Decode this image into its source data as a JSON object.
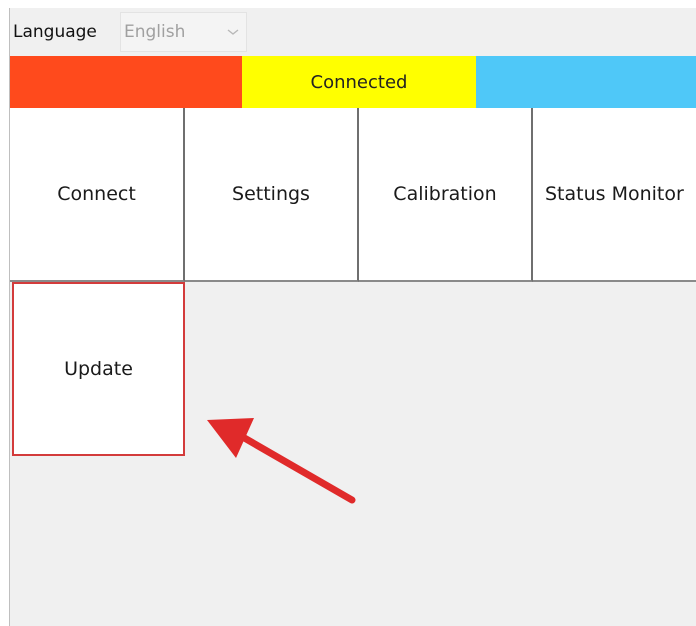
{
  "language": {
    "label": "Language",
    "selected": "English"
  },
  "status_bar": {
    "text": "Connected",
    "colors": {
      "left": "#ff4a1c",
      "middle": "#ffff00",
      "right": "#4fc8f8"
    }
  },
  "tiles": {
    "connect": "Connect",
    "settings": "Settings",
    "calibration": "Calibration",
    "status_monitor": "Status Monitor",
    "update": "Update"
  },
  "annotation": {
    "color": "#e02a2a",
    "points_to": "Update"
  }
}
